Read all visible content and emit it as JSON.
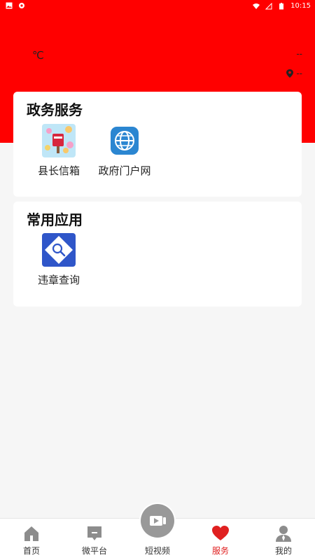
{
  "status": {
    "time": "10:15"
  },
  "header": {
    "temp_unit": "℃",
    "info_line1": "--",
    "info_line2": "--"
  },
  "gov": {
    "title": "政务服务",
    "apps": [
      {
        "label": "县长信箱"
      },
      {
        "label": "政府门户网"
      }
    ]
  },
  "common": {
    "title": "常用应用",
    "apps": [
      {
        "label": "违章查询"
      }
    ]
  },
  "tabs": [
    {
      "label": "首页"
    },
    {
      "label": "微平台"
    },
    {
      "label": "短视频"
    },
    {
      "label": "服务",
      "active": true
    },
    {
      "label": "我的"
    }
  ],
  "colors": {
    "brand": "#ff0000",
    "active": "#e02020"
  }
}
